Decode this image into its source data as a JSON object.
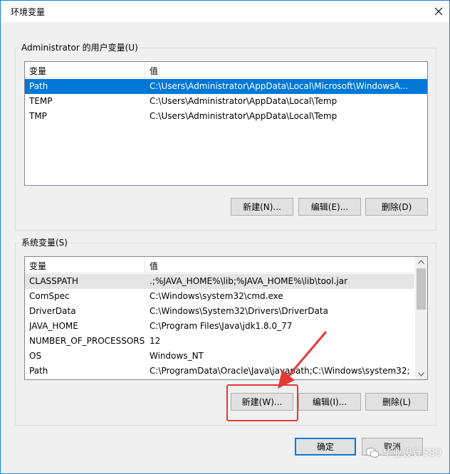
{
  "window": {
    "title": "环境变量"
  },
  "user_group": {
    "legend": "Administrator 的用户变量(U)",
    "columns": [
      "变量",
      "值"
    ],
    "rows": [
      [
        "Path",
        "C:\\Users\\Administrator\\AppData\\Local\\Microsoft\\WindowsA..."
      ],
      [
        "TEMP",
        "C:\\Users\\Administrator\\AppData\\Local\\Temp"
      ],
      [
        "TMP",
        "C:\\Users\\Administrator\\AppData\\Local\\Temp"
      ]
    ],
    "buttons": {
      "new": "新建(N)...",
      "edit": "编辑(E)...",
      "delete": "删除(D)"
    }
  },
  "system_group": {
    "legend": "系统变量(S)",
    "columns": [
      "变量",
      "值"
    ],
    "rows": [
      [
        "CLASSPATH",
        ".;%JAVA_HOME%\\lib;%JAVA_HOME%\\lib\\tool.jar"
      ],
      [
        "ComSpec",
        "C:\\Windows\\system32\\cmd.exe"
      ],
      [
        "DriverData",
        "C:\\Windows\\System32\\Drivers\\DriverData"
      ],
      [
        "JAVA_HOME",
        "C:\\Program Files\\Java\\jdk1.8.0_77"
      ],
      [
        "NUMBER_OF_PROCESSORS",
        "12"
      ],
      [
        "OS",
        "Windows_NT"
      ],
      [
        "Path",
        "C:\\ProgramData\\Oracle\\Java\\javapath;C:\\Windows\\system32;..."
      ]
    ],
    "buttons": {
      "new": "新建(W)...",
      "edit": "编辑(I)...",
      "delete": "删除(L)"
    }
  },
  "footer": {
    "ok": "确定",
    "cancel": "取消"
  },
  "watermark": "毕业设计580",
  "colors": {
    "accent": "#0078d7",
    "annotation": "#e53935"
  }
}
